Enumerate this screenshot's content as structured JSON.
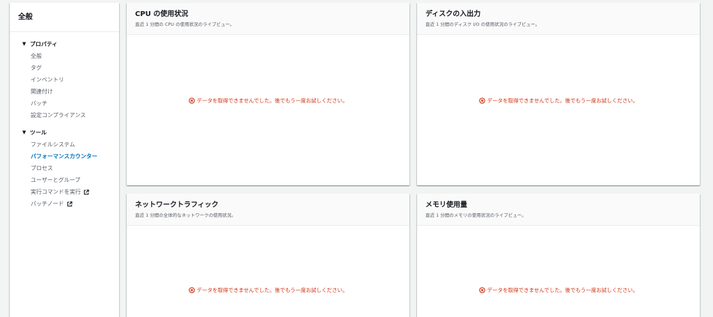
{
  "sidebar": {
    "title": "全般",
    "groups": [
      {
        "title": "プロパティ",
        "items": [
          "全般",
          "タグ",
          "インベントリ",
          "関連付け",
          "パッチ",
          "設定コンプライアンス"
        ]
      },
      {
        "title": "ツール",
        "items": [
          "ファイルシステム",
          "パフォーマンスカウンター",
          "プロセス",
          "ユーザーとグループ",
          "実行コマンドを実行",
          "パッチノード"
        ]
      }
    ]
  },
  "panels": [
    {
      "title": "CPU の使用状況",
      "description": "直近 1 分間の CPU の使用状況のライブビュー。",
      "error": "データを取得できませんでした。後でもう一度お試しください。"
    },
    {
      "title": "ディスクの入出力",
      "description": "直近 1 分間のディスク I/O の使用状況のライブビュー。",
      "error": "データを取得できませんでした。後でもう一度お試しください。"
    },
    {
      "title": "ネットワークトラフィック",
      "description": "直近 1 分間の全体的なネットワークの使用状況。",
      "error": "データを取得できませんでした。後でもう一度お試しください。"
    },
    {
      "title": "メモリ使用量",
      "description": "直近 1 分間のメモリの使用状況のライブビュー。",
      "error": "データを取得できませんでした。後でもう一度お試しください。"
    }
  ],
  "colors": {
    "active_link": "#0073bb",
    "error": "#d13212",
    "background": "#f2f3f3"
  },
  "active_item": "パフォーマンスカウンター"
}
